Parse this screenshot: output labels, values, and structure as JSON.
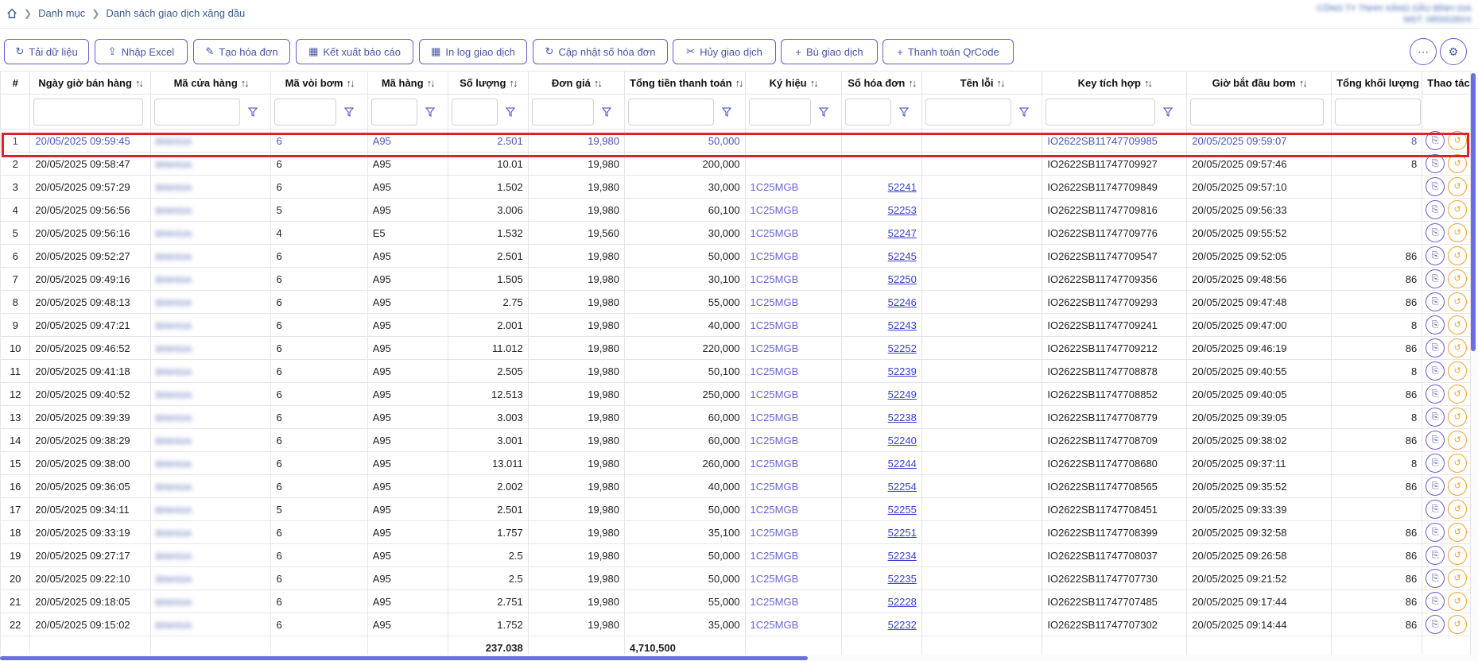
{
  "breadcrumb": {
    "items": [
      "Danh mục",
      "Danh sách giao dịch xăng dầu"
    ]
  },
  "company": {
    "line1": "CÔNG TY TNHH XĂNG DẦU BÌNH GIA",
    "line2": "MST: 0850028XX"
  },
  "toolbar": {
    "buttons": [
      {
        "label": "Tải dữ liệu",
        "icon": "refresh-icon"
      },
      {
        "label": "Nhập Excel",
        "icon": "upload-icon"
      },
      {
        "label": "Tạo hóa đơn",
        "icon": "pencil-icon"
      },
      {
        "label": "Kết xuất báo cáo",
        "icon": "grid-icon"
      },
      {
        "label": "In log giao dịch",
        "icon": "grid-icon"
      },
      {
        "label": "Cập nhật số hóa đơn",
        "icon": "refresh-icon"
      },
      {
        "label": "Hủy giao dịch",
        "icon": "cancel-icon"
      },
      {
        "label": "Bù giao dịch",
        "icon": "plus-icon"
      },
      {
        "label": "Thanh toán QrCode",
        "icon": "plus-icon"
      }
    ]
  },
  "table": {
    "columns": [
      "#",
      "Ngày giờ bán hàng",
      "Mã cửa hàng",
      "Mã vòi bơm",
      "Mã hàng",
      "Số lượng",
      "Đơn giá",
      "Tổng tiền thanh toán",
      "Ký hiệu",
      "Số hóa đơn",
      "Tên lỗi",
      "Key tích hợp",
      "Giờ bắt đầu bơm",
      "Tổng khối lượng đ",
      "Thao tác"
    ],
    "store_code": "BINHGIA",
    "rows": [
      {
        "n": "1",
        "time": "20/05/2025 09:59:45",
        "pump": "6",
        "item": "A95",
        "qty": "2.501",
        "price": "19,980",
        "total": "50,000",
        "sym": "",
        "inv": "",
        "key": "IO2622SB11747709985",
        "start": "20/05/2025 09:59:07",
        "vol": "8"
      },
      {
        "n": "2",
        "time": "20/05/2025 09:58:47",
        "pump": "6",
        "item": "A95",
        "qty": "10.01",
        "price": "19,980",
        "total": "200,000",
        "sym": "",
        "inv": "",
        "key": "IO2622SB11747709927",
        "start": "20/05/2025 09:57:46",
        "vol": "8"
      },
      {
        "n": "3",
        "time": "20/05/2025 09:57:29",
        "pump": "6",
        "item": "A95",
        "qty": "1.502",
        "price": "19,980",
        "total": "30,000",
        "sym": "1C25MGB",
        "inv": "52241",
        "key": "IO2622SB11747709849",
        "start": "20/05/2025 09:57:10",
        "vol": ""
      },
      {
        "n": "4",
        "time": "20/05/2025 09:56:56",
        "pump": "5",
        "item": "A95",
        "qty": "3.006",
        "price": "19,980",
        "total": "60,100",
        "sym": "1C25MGB",
        "inv": "52253",
        "key": "IO2622SB11747709816",
        "start": "20/05/2025 09:56:33",
        "vol": ""
      },
      {
        "n": "5",
        "time": "20/05/2025 09:56:16",
        "pump": "4",
        "item": "E5",
        "qty": "1.532",
        "price": "19,560",
        "total": "30,000",
        "sym": "1C25MGB",
        "inv": "52247",
        "key": "IO2622SB11747709776",
        "start": "20/05/2025 09:55:52",
        "vol": ""
      },
      {
        "n": "6",
        "time": "20/05/2025 09:52:27",
        "pump": "6",
        "item": "A95",
        "qty": "2.501",
        "price": "19,980",
        "total": "50,000",
        "sym": "1C25MGB",
        "inv": "52245",
        "key": "IO2622SB11747709547",
        "start": "20/05/2025 09:52:05",
        "vol": "86"
      },
      {
        "n": "7",
        "time": "20/05/2025 09:49:16",
        "pump": "6",
        "item": "A95",
        "qty": "1.505",
        "price": "19,980",
        "total": "30,100",
        "sym": "1C25MGB",
        "inv": "52250",
        "key": "IO2622SB11747709356",
        "start": "20/05/2025 09:48:56",
        "vol": "86"
      },
      {
        "n": "8",
        "time": "20/05/2025 09:48:13",
        "pump": "6",
        "item": "A95",
        "qty": "2.75",
        "price": "19,980",
        "total": "55,000",
        "sym": "1C25MGB",
        "inv": "52246",
        "key": "IO2622SB11747709293",
        "start": "20/05/2025 09:47:48",
        "vol": "86"
      },
      {
        "n": "9",
        "time": "20/05/2025 09:47:21",
        "pump": "6",
        "item": "A95",
        "qty": "2.001",
        "price": "19,980",
        "total": "40,000",
        "sym": "1C25MGB",
        "inv": "52243",
        "key": "IO2622SB11747709241",
        "start": "20/05/2025 09:47:00",
        "vol": "8"
      },
      {
        "n": "10",
        "time": "20/05/2025 09:46:52",
        "pump": "6",
        "item": "A95",
        "qty": "11.012",
        "price": "19,980",
        "total": "220,000",
        "sym": "1C25MGB",
        "inv": "52252",
        "key": "IO2622SB11747709212",
        "start": "20/05/2025 09:46:19",
        "vol": "86"
      },
      {
        "n": "11",
        "time": "20/05/2025 09:41:18",
        "pump": "6",
        "item": "A95",
        "qty": "2.505",
        "price": "19,980",
        "total": "50,100",
        "sym": "1C25MGB",
        "inv": "52239",
        "key": "IO2622SB11747708878",
        "start": "20/05/2025 09:40:55",
        "vol": "8"
      },
      {
        "n": "12",
        "time": "20/05/2025 09:40:52",
        "pump": "6",
        "item": "A95",
        "qty": "12.513",
        "price": "19,980",
        "total": "250,000",
        "sym": "1C25MGB",
        "inv": "52249",
        "key": "IO2622SB11747708852",
        "start": "20/05/2025 09:40:05",
        "vol": "86"
      },
      {
        "n": "13",
        "time": "20/05/2025 09:39:39",
        "pump": "6",
        "item": "A95",
        "qty": "3.003",
        "price": "19,980",
        "total": "60,000",
        "sym": "1C25MGB",
        "inv": "52238",
        "key": "IO2622SB11747708779",
        "start": "20/05/2025 09:39:05",
        "vol": "8"
      },
      {
        "n": "14",
        "time": "20/05/2025 09:38:29",
        "pump": "6",
        "item": "A95",
        "qty": "3.001",
        "price": "19,980",
        "total": "60,000",
        "sym": "1C25MGB",
        "inv": "52240",
        "key": "IO2622SB11747708709",
        "start": "20/05/2025 09:38:02",
        "vol": "86"
      },
      {
        "n": "15",
        "time": "20/05/2025 09:38:00",
        "pump": "6",
        "item": "A95",
        "qty": "13.011",
        "price": "19,980",
        "total": "260,000",
        "sym": "1C25MGB",
        "inv": "52244",
        "key": "IO2622SB11747708680",
        "start": "20/05/2025 09:37:11",
        "vol": "8"
      },
      {
        "n": "16",
        "time": "20/05/2025 09:36:05",
        "pump": "6",
        "item": "A95",
        "qty": "2.002",
        "price": "19,980",
        "total": "40,000",
        "sym": "1C25MGB",
        "inv": "52254",
        "key": "IO2622SB11747708565",
        "start": "20/05/2025 09:35:52",
        "vol": "86"
      },
      {
        "n": "17",
        "time": "20/05/2025 09:34:11",
        "pump": "5",
        "item": "A95",
        "qty": "2.501",
        "price": "19,980",
        "total": "50,000",
        "sym": "1C25MGB",
        "inv": "52255",
        "key": "IO2622SB11747708451",
        "start": "20/05/2025 09:33:39",
        "vol": ""
      },
      {
        "n": "18",
        "time": "20/05/2025 09:33:19",
        "pump": "6",
        "item": "A95",
        "qty": "1.757",
        "price": "19,980",
        "total": "35,100",
        "sym": "1C25MGB",
        "inv": "52251",
        "key": "IO2622SB11747708399",
        "start": "20/05/2025 09:32:58",
        "vol": "86"
      },
      {
        "n": "19",
        "time": "20/05/2025 09:27:17",
        "pump": "6",
        "item": "A95",
        "qty": "2.5",
        "price": "19,980",
        "total": "50,000",
        "sym": "1C25MGB",
        "inv": "52234",
        "key": "IO2622SB11747708037",
        "start": "20/05/2025 09:26:58",
        "vol": "86"
      },
      {
        "n": "20",
        "time": "20/05/2025 09:22:10",
        "pump": "6",
        "item": "A95",
        "qty": "2.5",
        "price": "19,980",
        "total": "50,000",
        "sym": "1C25MGB",
        "inv": "52235",
        "key": "IO2622SB11747707730",
        "start": "20/05/2025 09:21:52",
        "vol": "86"
      },
      {
        "n": "21",
        "time": "20/05/2025 09:18:05",
        "pump": "6",
        "item": "A95",
        "qty": "2.751",
        "price": "19,980",
        "total": "55,000",
        "sym": "1C25MGB",
        "inv": "52228",
        "key": "IO2622SB11747707485",
        "start": "20/05/2025 09:17:44",
        "vol": "86"
      },
      {
        "n": "22",
        "time": "20/05/2025 09:15:02",
        "pump": "6",
        "item": "A95",
        "qty": "1.752",
        "price": "19,980",
        "total": "35,000",
        "sym": "1C25MGB",
        "inv": "52232",
        "key": "IO2622SB11747707302",
        "start": "20/05/2025 09:14:44",
        "vol": "86"
      }
    ],
    "footer": {
      "qty_total": "237.038",
      "amount_total": "4,710,500"
    }
  }
}
